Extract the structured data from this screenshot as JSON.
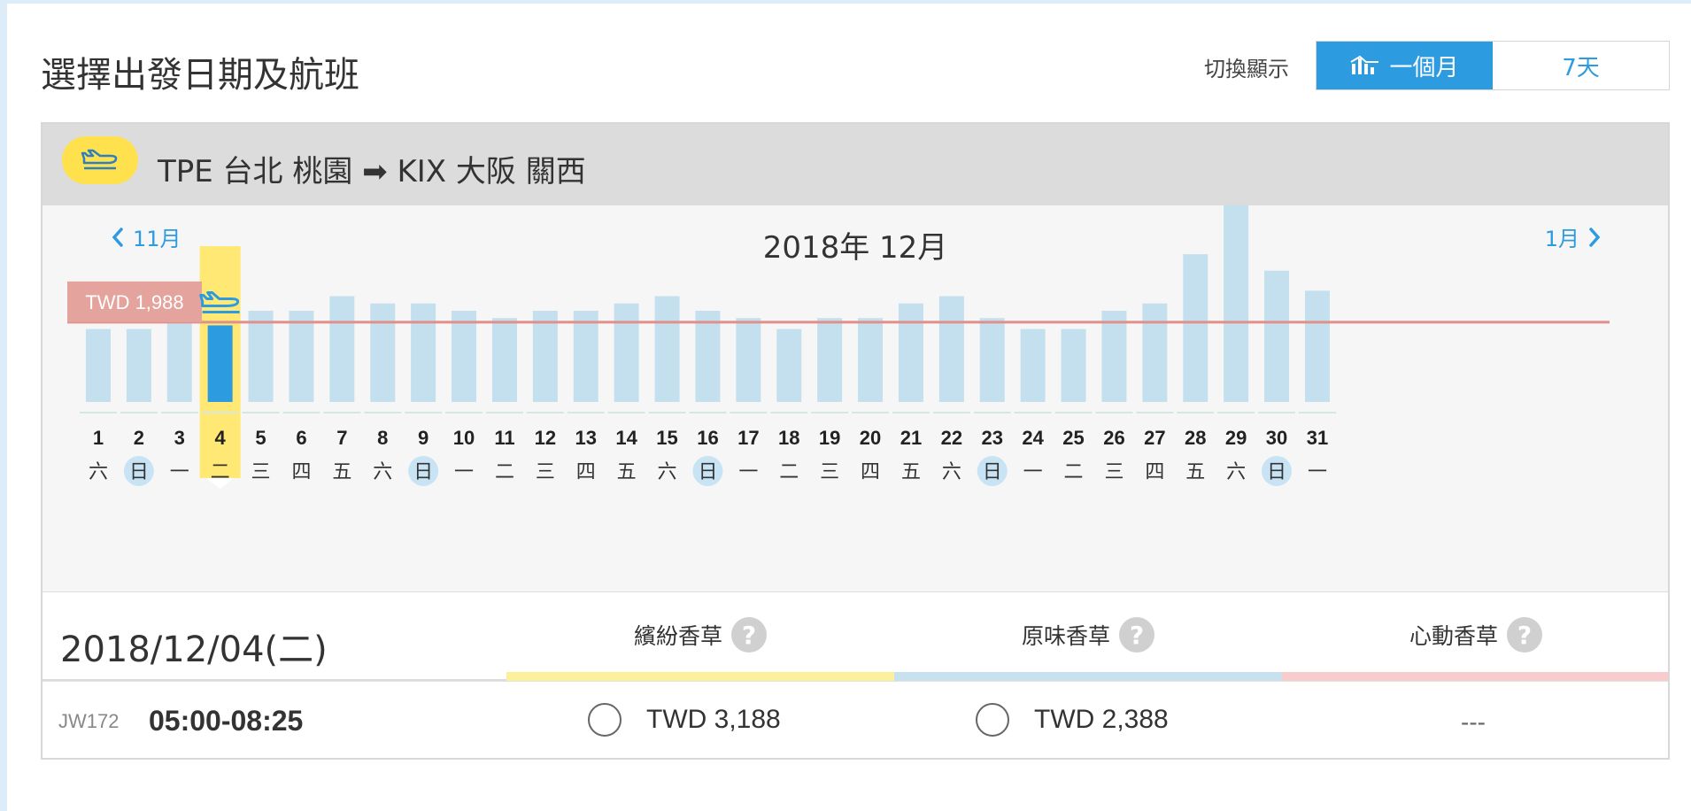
{
  "header": {
    "title": "選擇出發日期及航班",
    "switch_label": "切換顯示",
    "toggle": [
      {
        "label": "一個月",
        "active": true
      },
      {
        "label": "7天",
        "active": false
      }
    ]
  },
  "route": {
    "text": "TPE 台北 桃園 ➡ KIX 大阪 關西"
  },
  "calendar": {
    "prev_month": "11月",
    "next_month": "1月",
    "current_month": "2018年 12月",
    "selected_day": 4
  },
  "chart_data": {
    "type": "bar",
    "title": "",
    "categories": [
      "1",
      "2",
      "3",
      "4",
      "5",
      "6",
      "7",
      "8",
      "9",
      "10",
      "11",
      "12",
      "13",
      "14",
      "15",
      "16",
      "17",
      "18",
      "19",
      "20",
      "21",
      "22",
      "23",
      "24",
      "25",
      "26",
      "27",
      "28",
      "29",
      "30",
      "31"
    ],
    "weekdays": [
      "六",
      "日",
      "一",
      "二",
      "三",
      "四",
      "五",
      "六",
      "日",
      "一",
      "二",
      "三",
      "四",
      "五",
      "六",
      "日",
      "一",
      "二",
      "三",
      "四",
      "五",
      "六",
      "日",
      "一",
      "二",
      "三",
      "四",
      "五",
      "六",
      "日",
      "一"
    ],
    "values": [
      2000,
      2000,
      2150,
      2100,
      2500,
      2500,
      2900,
      2700,
      2700,
      2500,
      2300,
      2500,
      2500,
      2700,
      2900,
      2500,
      2300,
      2000,
      2300,
      2300,
      2700,
      2900,
      2300,
      2000,
      2000,
      2500,
      2700,
      4050,
      5400,
      3600,
      3050
    ],
    "reference_line": {
      "value": 1988,
      "label": "TWD 1,988"
    },
    "weekend_days": [
      2,
      9,
      16,
      23,
      30
    ],
    "colors": {
      "bar": "#c4e0ee",
      "selected_bar": "#2d9be0",
      "highlight": "#ffe873",
      "reference_line": "#e0908a",
      "reference_label_bg": "#e4a39c",
      "weekend_circle": "#c8e4f4"
    }
  },
  "detail": {
    "date": "2018/12/04(二)",
    "fares": [
      {
        "name": "繽紛香草",
        "color": "#fdf09a"
      },
      {
        "name": "原味香草",
        "color": "#c8e1ee"
      },
      {
        "name": "心動香草",
        "color": "#f8cccc"
      }
    ],
    "help_glyph": "?",
    "flight": {
      "number": "JW172",
      "time": "05:00-08:25",
      "prices": [
        "TWD 3,188",
        "TWD 2,388",
        "---"
      ]
    }
  }
}
